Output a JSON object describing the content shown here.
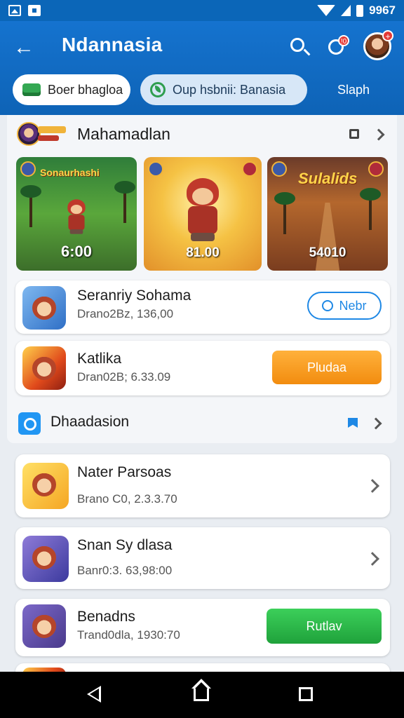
{
  "status_bar": {
    "time": "9967"
  },
  "header": {
    "title": "Ndannasia",
    "notification_count": "!0",
    "avatar_badge": "+"
  },
  "chips": [
    {
      "label": "Boer bhagloa"
    },
    {
      "label": "Oup hsbnii: Banasia"
    },
    {
      "label": "Slaph"
    }
  ],
  "section_one": {
    "title": "Mahamadlan",
    "banners": [
      {
        "title": "Sonaurhashi",
        "price": "6:00"
      },
      {
        "title": "",
        "price": "81.00"
      },
      {
        "title": "Sulalids",
        "price": "54010"
      }
    ],
    "apps": [
      {
        "name": "Seranriy Sohama",
        "sub": "Drano2Bz, 136,00",
        "action": "Nebr"
      },
      {
        "name": "Katlika",
        "sub": "Dran02B; 6.33.09",
        "action": "Pludaa"
      }
    ]
  },
  "section_two": {
    "title": "Dhaadasion",
    "apps": [
      {
        "name": "Nater Parsoas",
        "sub": "Brano C0, 2.3.3.70"
      },
      {
        "name": "Snan Sy dlasa",
        "sub": "Banr0:3. 63,98:00"
      },
      {
        "name": "Benadns",
        "sub": "Trand0dla, 1930:70",
        "action": "Rutlav"
      }
    ]
  },
  "colors": {
    "header_blue": "#1573cf",
    "accent_orange": "#f28c0f",
    "accent_green": "#1fa23b",
    "link_blue": "#1e88e5"
  },
  "icons": [
    "image-icon",
    "bag-icon",
    "wifi-icon",
    "signal-icon",
    "battery-icon",
    "back-arrow-icon",
    "search-icon",
    "notification-icon",
    "avatar",
    "chevron-right-icon",
    "flag-icon",
    "nav-back-icon",
    "nav-home-icon",
    "nav-recent-icon"
  ]
}
